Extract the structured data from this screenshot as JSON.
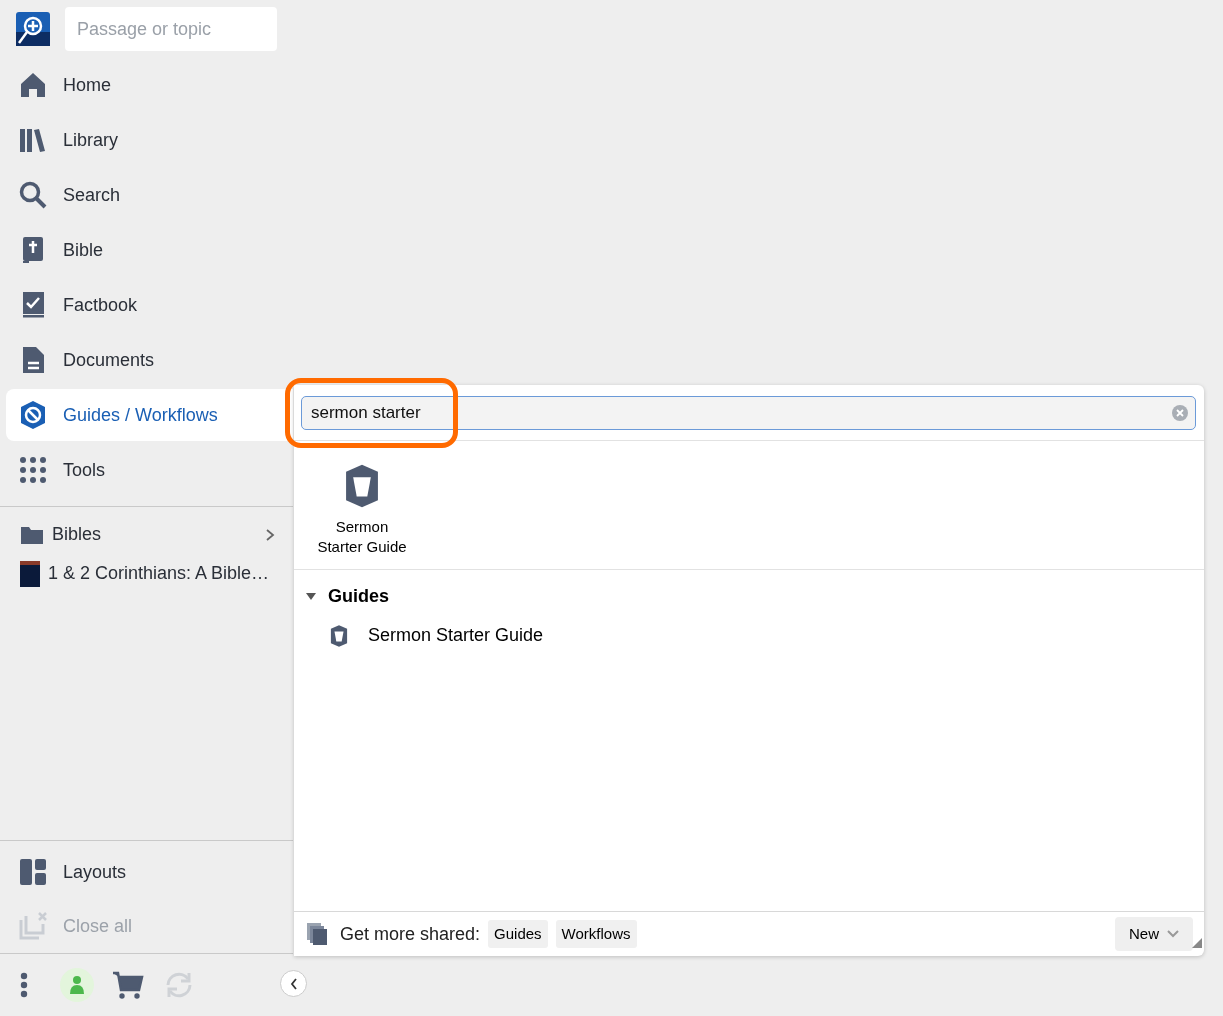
{
  "search": {
    "placeholder": "Passage or topic"
  },
  "nav": [
    {
      "kind": "home",
      "label": "Home",
      "selected": false
    },
    {
      "kind": "library",
      "label": "Library",
      "selected": false
    },
    {
      "kind": "search",
      "label": "Search",
      "selected": false
    },
    {
      "kind": "bible",
      "label": "Bible",
      "selected": false
    },
    {
      "kind": "factbook",
      "label": "Factbook",
      "selected": false
    },
    {
      "kind": "documents",
      "label": "Documents",
      "selected": false
    },
    {
      "kind": "guides",
      "label": "Guides / Workflows",
      "selected": true
    },
    {
      "kind": "tools",
      "label": "Tools",
      "selected": false
    }
  ],
  "shelf": [
    {
      "kind": "folder",
      "label": "Bibles"
    },
    {
      "kind": "book",
      "label": "1 & 2 Corinthians: A Bible…"
    }
  ],
  "layout_actions": [
    {
      "kind": "layouts",
      "label": "Layouts",
      "disabled": false
    },
    {
      "kind": "close",
      "label": "Close all",
      "disabled": true
    }
  ],
  "panel": {
    "query": "sermon starter",
    "highlighted": true,
    "tiles": [
      {
        "label": "Sermon Starter Guide"
      }
    ],
    "groups": [
      {
        "title": "Guides",
        "expanded": true,
        "items": [
          {
            "label": "Sermon Starter Guide"
          }
        ]
      }
    ],
    "footer": {
      "label": "Get more shared:",
      "links": [
        "Guides",
        "Workflows"
      ],
      "new_button": "New"
    }
  }
}
